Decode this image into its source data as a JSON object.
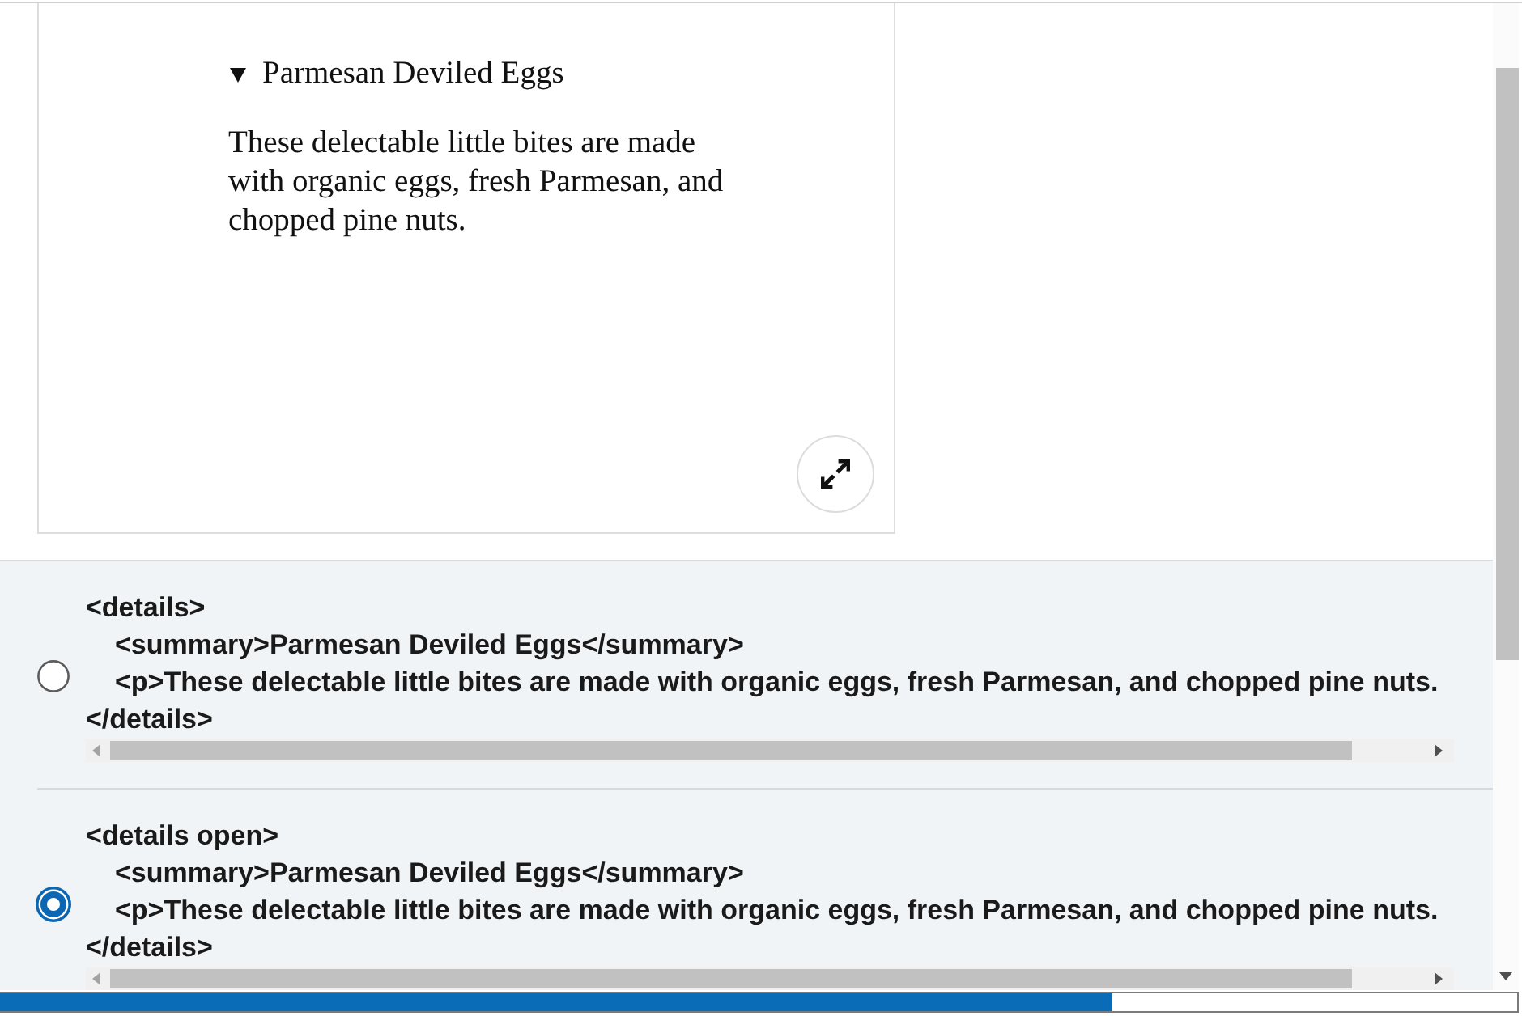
{
  "preview": {
    "summary": {
      "text": "Parmesan Deviled Eggs",
      "expanded": true
    },
    "paragraph": "These delectable little bites are made with organic eggs, fresh Parmesan, and chopped pine nuts."
  },
  "options": [
    {
      "selected": false,
      "code": {
        "open_tag": "<details>",
        "children": [
          "<summary>Parmesan Deviled Eggs</summary>",
          "<p>These delectable little bites are made with organic eggs, fresh Parmesan, and chopped pine nuts."
        ],
        "close_tag": "</details>"
      }
    },
    {
      "selected": true,
      "code": {
        "open_tag": "<details open>",
        "children": [
          "<summary>Parmesan Deviled Eggs</summary>",
          "<p>These delectable little bites are made with organic eggs, fresh Parmesan, and chopped pine nuts."
        ],
        "close_tag": "</details>"
      }
    }
  ],
  "progress": {
    "level": 0.733
  }
}
